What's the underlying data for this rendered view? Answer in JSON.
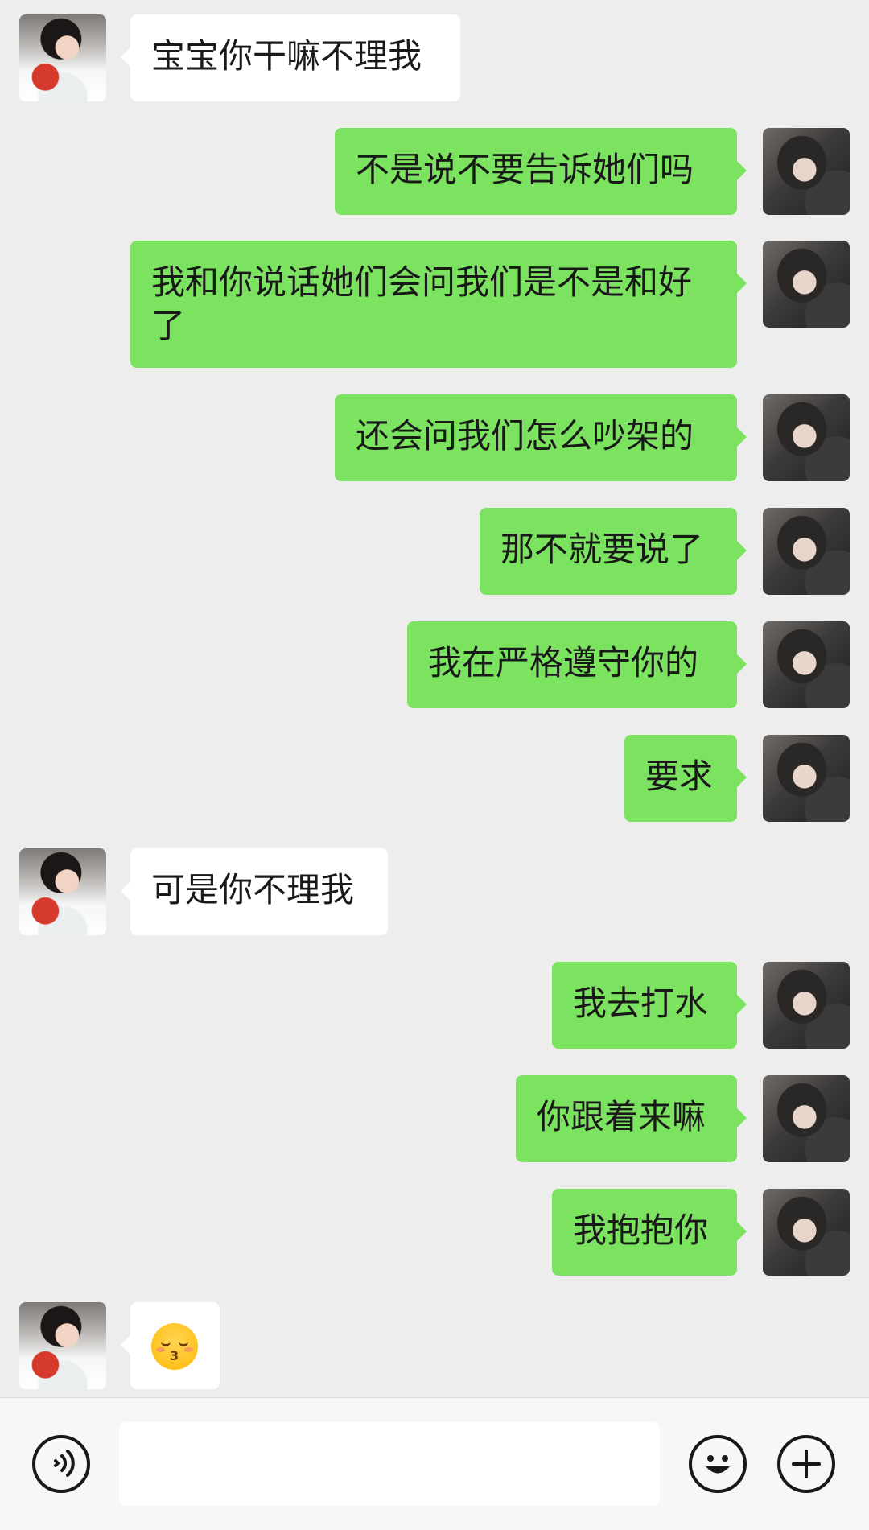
{
  "messages": [
    {
      "side": "in",
      "text": "宝宝你干嘛不理我"
    },
    {
      "side": "out",
      "text": "不是说不要告诉她们吗"
    },
    {
      "side": "out",
      "text": "我和你说话她们会问我们是不是和好了"
    },
    {
      "side": "out",
      "text": "还会问我们怎么吵架的"
    },
    {
      "side": "out",
      "text": "那不就要说了"
    },
    {
      "side": "out",
      "text": "我在严格遵守你的"
    },
    {
      "side": "out",
      "text": "要求"
    },
    {
      "side": "in",
      "text": "可是你不理我"
    },
    {
      "side": "out",
      "text": "我去打水"
    },
    {
      "side": "out",
      "text": "你跟着来嘛"
    },
    {
      "side": "out",
      "text": "我抱抱你"
    },
    {
      "side": "in",
      "emoji": "kissing-face-with-smiling-eyes"
    }
  ],
  "input_bar": {
    "voice_icon": "voice-icon",
    "input_value": "",
    "emoji_icon": "emoji-icon",
    "plus_icon": "plus-icon"
  },
  "colors": {
    "background": "#ededed",
    "incoming_bubble": "#ffffff",
    "outgoing_bubble": "#7be35f"
  }
}
